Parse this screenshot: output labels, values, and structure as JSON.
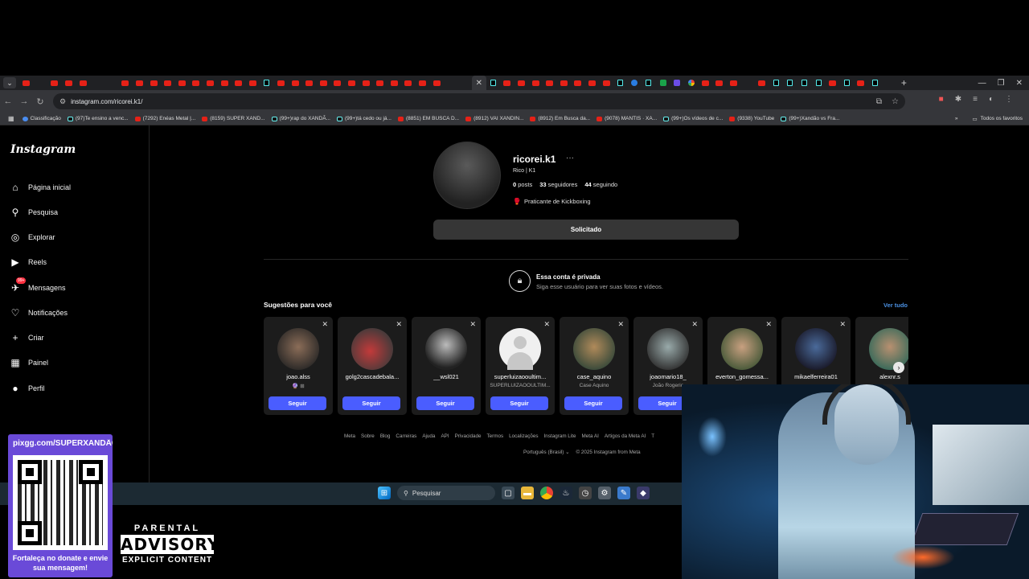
{
  "browser": {
    "url": "instagram.com/ricorei.k1/",
    "tab_favicons": [
      "yt",
      "ig",
      "yt",
      "yt",
      "yt",
      "ig",
      "ig",
      "yt",
      "yt",
      "yt",
      "yt",
      "yt",
      "yt",
      "yt",
      "yt",
      "yt",
      "yt",
      "tt",
      "yt",
      "yt",
      "yt",
      "yt",
      "yt",
      "yt",
      "yt",
      "yt",
      "yt",
      "yt",
      "yt",
      "yt",
      "ig",
      "ig",
      "active",
      "tt",
      "yt",
      "yt",
      "yt",
      "yt",
      "yt",
      "yt",
      "yt",
      "yt",
      "tt",
      "bl",
      "tt",
      "gr",
      "vi",
      "go",
      "yt",
      "yt",
      "yt",
      "ig",
      "yt",
      "tt",
      "tt",
      "tt",
      "tt",
      "yt",
      "tt",
      "yt",
      "tt",
      "ig"
    ],
    "bookmarks": [
      {
        "icon": "bl",
        "label": "Classificação"
      },
      {
        "icon": "tt",
        "label": "(97)Te ensino a venc..."
      },
      {
        "icon": "yt",
        "label": "(7292) Enéas Metal |..."
      },
      {
        "icon": "yt",
        "label": "(8159) SUPER XAND..."
      },
      {
        "icon": "tt",
        "label": "(99+)rap do XANDÃ..."
      },
      {
        "icon": "tt",
        "label": "(99+)tá cedo ou já..."
      },
      {
        "icon": "yt",
        "label": "(8851) EM BUSCA D..."
      },
      {
        "icon": "yt",
        "label": "(8912) VAI XANDIN..."
      },
      {
        "icon": "yt",
        "label": "(8912) Em Busca da..."
      },
      {
        "icon": "yt",
        "label": "(9078) MANTIS · XA..."
      },
      {
        "icon": "tt",
        "label": "(99+)Os vídeos de c..."
      },
      {
        "icon": "yt",
        "label": "(9338) YouTube"
      },
      {
        "icon": "tt",
        "label": "(99+)Xandão vs Fra..."
      }
    ],
    "all_bookmarks": "Todos os favoritos"
  },
  "sidebar": {
    "logo": "Instagram",
    "items": [
      {
        "label": "Página inicial",
        "icon": "home-icon",
        "glyph": "⌂"
      },
      {
        "label": "Pesquisa",
        "icon": "search-icon",
        "glyph": "⚲"
      },
      {
        "label": "Explorar",
        "icon": "explore-icon",
        "glyph": "◎"
      },
      {
        "label": "Reels",
        "icon": "reels-icon",
        "glyph": "▶"
      },
      {
        "label": "Mensagens",
        "icon": "messages-icon",
        "glyph": "✈",
        "badge": "99+"
      },
      {
        "label": "Notificações",
        "icon": "heart-icon",
        "glyph": "♡"
      },
      {
        "label": "Criar",
        "icon": "plus-icon",
        "glyph": "+"
      },
      {
        "label": "Painel",
        "icon": "dashboard-icon",
        "glyph": "▦"
      },
      {
        "label": "Perfil",
        "icon": "profile-avatar-icon",
        "glyph": "●"
      }
    ]
  },
  "profile": {
    "username": "ricorei.k1",
    "more": "···",
    "name": "Rico | K1",
    "posts_count": "0",
    "posts_label": "posts",
    "followers_count": "33",
    "followers_label": "seguidores",
    "following_count": "44",
    "following_label": "seguindo",
    "bio_icon": "🥊",
    "bio": "Praticante de Kickboxing",
    "request_button": "Solicitado"
  },
  "private": {
    "title": "Essa conta é privada",
    "subtitle": "Siga esse usuário para ver suas fotos e vídeos."
  },
  "suggestions": {
    "heading": "Sugestões para você",
    "see_all": "Ver tudo",
    "follow_label": "Seguir",
    "items": [
      {
        "username": "joao.alss",
        "sub": "🔮 ⊞",
        "pic": "c1"
      },
      {
        "username": "golg2cascadebala...",
        "sub": "",
        "pic": "c2"
      },
      {
        "username": "__wsl021",
        "sub": "",
        "pic": "c3"
      },
      {
        "username": "superluizaooultim...",
        "sub": "SUPERLUIZÃOOÚLTIM...",
        "pic": "def"
      },
      {
        "username": "case_aquino",
        "sub": "Case Aquino",
        "pic": "c5"
      },
      {
        "username": "joaomario18_",
        "sub": "João Rogerio",
        "pic": "c6"
      },
      {
        "username": "everton_gomessa...",
        "sub": "",
        "pic": "c7"
      },
      {
        "username": "mikaelferreira01",
        "sub": "",
        "pic": "c8"
      },
      {
        "username": "alexnr.s",
        "sub": "",
        "pic": "c9"
      }
    ]
  },
  "footer": {
    "links": [
      "Meta",
      "Sobre",
      "Blog",
      "Carreiras",
      "Ajuda",
      "API",
      "Privacidade",
      "Termos",
      "Localizações",
      "Instagram Lite",
      "Meta AI",
      "Artigos da Meta AI",
      "T"
    ],
    "language": "Português (Brasil)",
    "copyright": "© 2025 Instagram from Meta"
  },
  "taskbar": {
    "search_placeholder": "Pesquisar"
  },
  "overlay": {
    "qr_title": "pixgg.com/SUPERXANDÃO",
    "qr_text": "Fortaleça no donate e envie sua mensagem!",
    "parental_1": "PARENTAL",
    "parental_2": "ADVISORY",
    "parental_3": "EXPLICIT CONTENT"
  }
}
